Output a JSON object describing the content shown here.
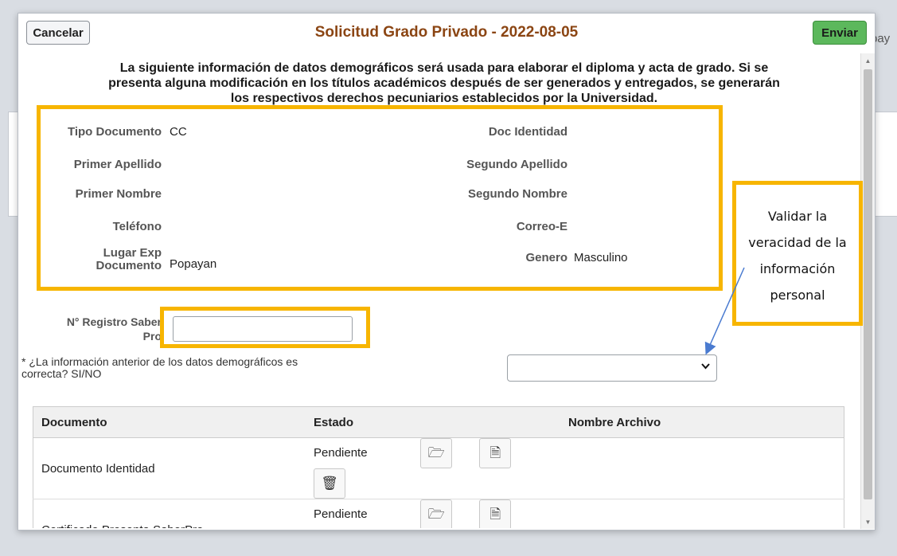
{
  "background": {
    "side_text": "pay"
  },
  "modal": {
    "cancel_label": "Cancelar",
    "title": "Solicitud Grado Privado - 2022-08-05",
    "send_label": "Enviar",
    "intro_lines": [
      "La siguiente información de datos demográficos será usada para elaborar el diploma y acta de grado. Si se",
      "presenta alguna modificación en los títulos académicos después de ser generados y entregados, se generarán",
      "los respectivos derechos pecuniarios establecidos por la Universidad."
    ]
  },
  "person": {
    "tipo_documento_label": "Tipo Documento",
    "tipo_documento_value": "CC",
    "doc_identidad_label": "Doc Identidad",
    "primer_apellido_label": "Primer Apellido",
    "segundo_apellido_label": "Segundo Apellido",
    "primer_nombre_label": "Primer Nombre",
    "segundo_nombre_label": "Segundo Nombre",
    "telefono_label": "Teléfono",
    "correo_label": "Correo-E",
    "lugar_exp_label_1": "Lugar Exp",
    "lugar_exp_label_2": "Documento",
    "lugar_exp_value": "Popayan",
    "genero_label": "Genero",
    "genero_value": "Masculino"
  },
  "form": {
    "saberpro_label_1": "N° Registro Saber",
    "saberpro_label_2": "Pro",
    "saberpro_value": "",
    "question_line_1": "* ¿La información anterior de los datos demográficos es",
    "question_line_2": "correcta? SI/NO",
    "question_selected": ""
  },
  "table": {
    "headers": [
      "Documento",
      "Estado",
      "Nombre Archivo"
    ],
    "rows": [
      {
        "documento": "Documento Identidad",
        "estado": "Pendiente"
      },
      {
        "documento": "Certificado Presenta SaberPro",
        "estado": "Pendiente"
      }
    ],
    "icons": [
      "folder-open-icon",
      "document-edit-icon",
      "trash-icon"
    ]
  },
  "callout": {
    "lines": [
      "Validar la",
      "veracidad de la",
      "información",
      "personal"
    ]
  },
  "colors": {
    "highlight": "#f7b500",
    "title": "#8b4513",
    "send_button": "#5cb85c",
    "arrow": "#4a7bd0"
  }
}
